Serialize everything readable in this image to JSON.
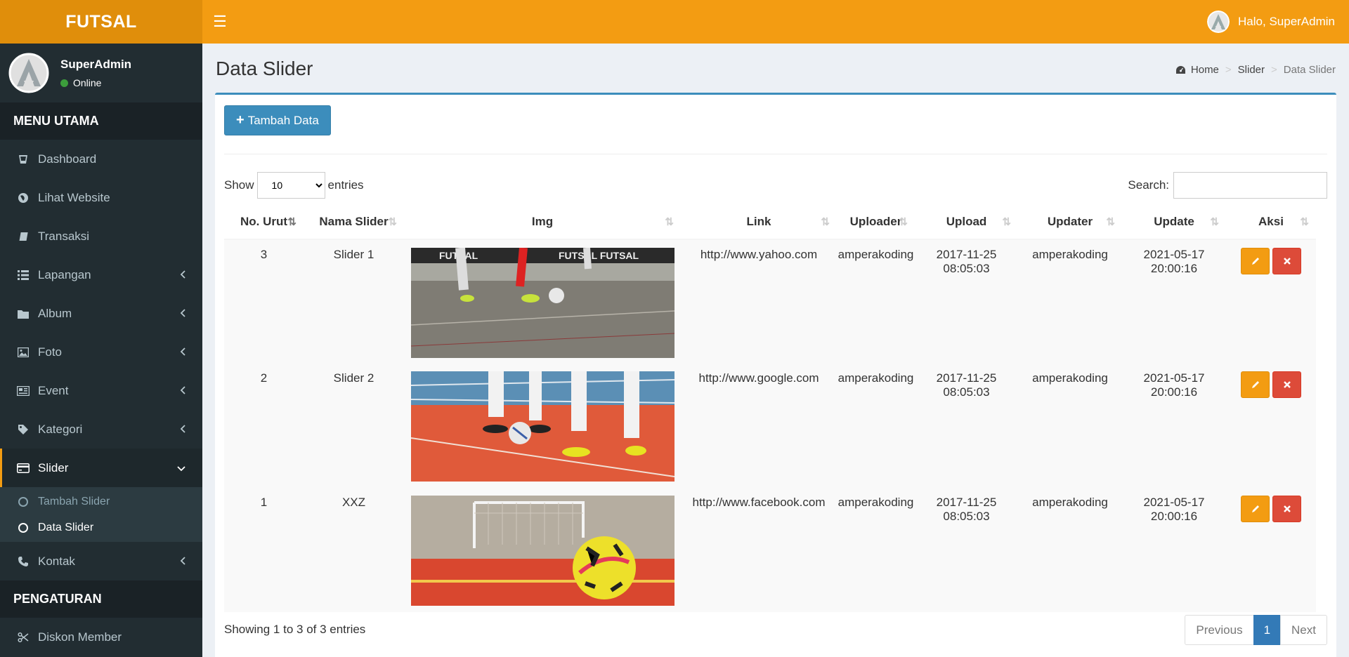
{
  "app": {
    "logo_text": "FUTSAL"
  },
  "topbar": {
    "greeting": "Halo, SuperAdmin"
  },
  "user_panel": {
    "name": "SuperAdmin",
    "status": "Online"
  },
  "sidebar": {
    "header_main": "MENU UTAMA",
    "items": [
      {
        "label": "Dashboard",
        "icon": "dashboard-icon"
      },
      {
        "label": "Lihat Website",
        "icon": "globe-icon"
      },
      {
        "label": "Transaksi",
        "icon": "book-icon"
      },
      {
        "label": "Lapangan",
        "icon": "list-icon"
      },
      {
        "label": "Album",
        "icon": "folder-icon"
      },
      {
        "label": "Foto",
        "icon": "image-icon"
      },
      {
        "label": "Event",
        "icon": "newspaper-icon"
      },
      {
        "label": "Kategori",
        "icon": "tag-icon"
      },
      {
        "label": "Slider",
        "icon": "credit-card-icon"
      },
      {
        "label": "Kontak",
        "icon": "phone-icon"
      }
    ],
    "slider_sub": [
      {
        "label": "Tambah Slider"
      },
      {
        "label": "Data Slider"
      }
    ],
    "header_settings": "PENGATURAN",
    "settings_items": [
      {
        "label": "Diskon Member",
        "icon": "scissors-icon"
      }
    ]
  },
  "page": {
    "title": "Data Slider",
    "breadcrumb": [
      "Home",
      "Slider",
      "Data Slider"
    ]
  },
  "toolbar": {
    "add_label": "Tambah Data"
  },
  "table_controls": {
    "show_label": "Show",
    "entries_label": "entries",
    "page_size": "10",
    "search_label": "Search:"
  },
  "table": {
    "columns": [
      "No. Urut",
      "Nama Slider",
      "Img",
      "Link",
      "Uploader",
      "Upload",
      "Updater",
      "Update",
      "Aksi"
    ],
    "rows": [
      {
        "no": "3",
        "name": "Slider 1",
        "img": "futsal-players-photo",
        "link": "http://www.yahoo.com",
        "uploader": "amperakoding",
        "upload": "2017-11-25 08:05:03",
        "updater": "amperakoding",
        "update": "2021-05-17 20:00:16"
      },
      {
        "no": "2",
        "name": "Slider 2",
        "img": "futsal-feet-ball-photo",
        "link": "http://www.google.com",
        "uploader": "amperakoding",
        "upload": "2017-11-25 08:05:03",
        "updater": "amperakoding",
        "update": "2021-05-17 20:00:16"
      },
      {
        "no": "1",
        "name": "XXZ",
        "img": "futsal-ball-goal-photo",
        "link": "http://www.facebook.com",
        "uploader": "amperakoding",
        "upload": "2017-11-25 08:05:03",
        "updater": "amperakoding",
        "update": "2021-05-17 20:00:16"
      }
    ]
  },
  "footer": {
    "info": "Showing 1 to 3 of 3 entries",
    "prev": "Previous",
    "page": "1",
    "next": "Next"
  },
  "colors": {
    "header_orange": "#f39c12",
    "logo_orange": "#e08e0b",
    "sidebar_dark": "#222d32",
    "primary_blue": "#3c8dbc",
    "edit_orange": "#f39c12",
    "delete_red": "#dd4b39"
  }
}
